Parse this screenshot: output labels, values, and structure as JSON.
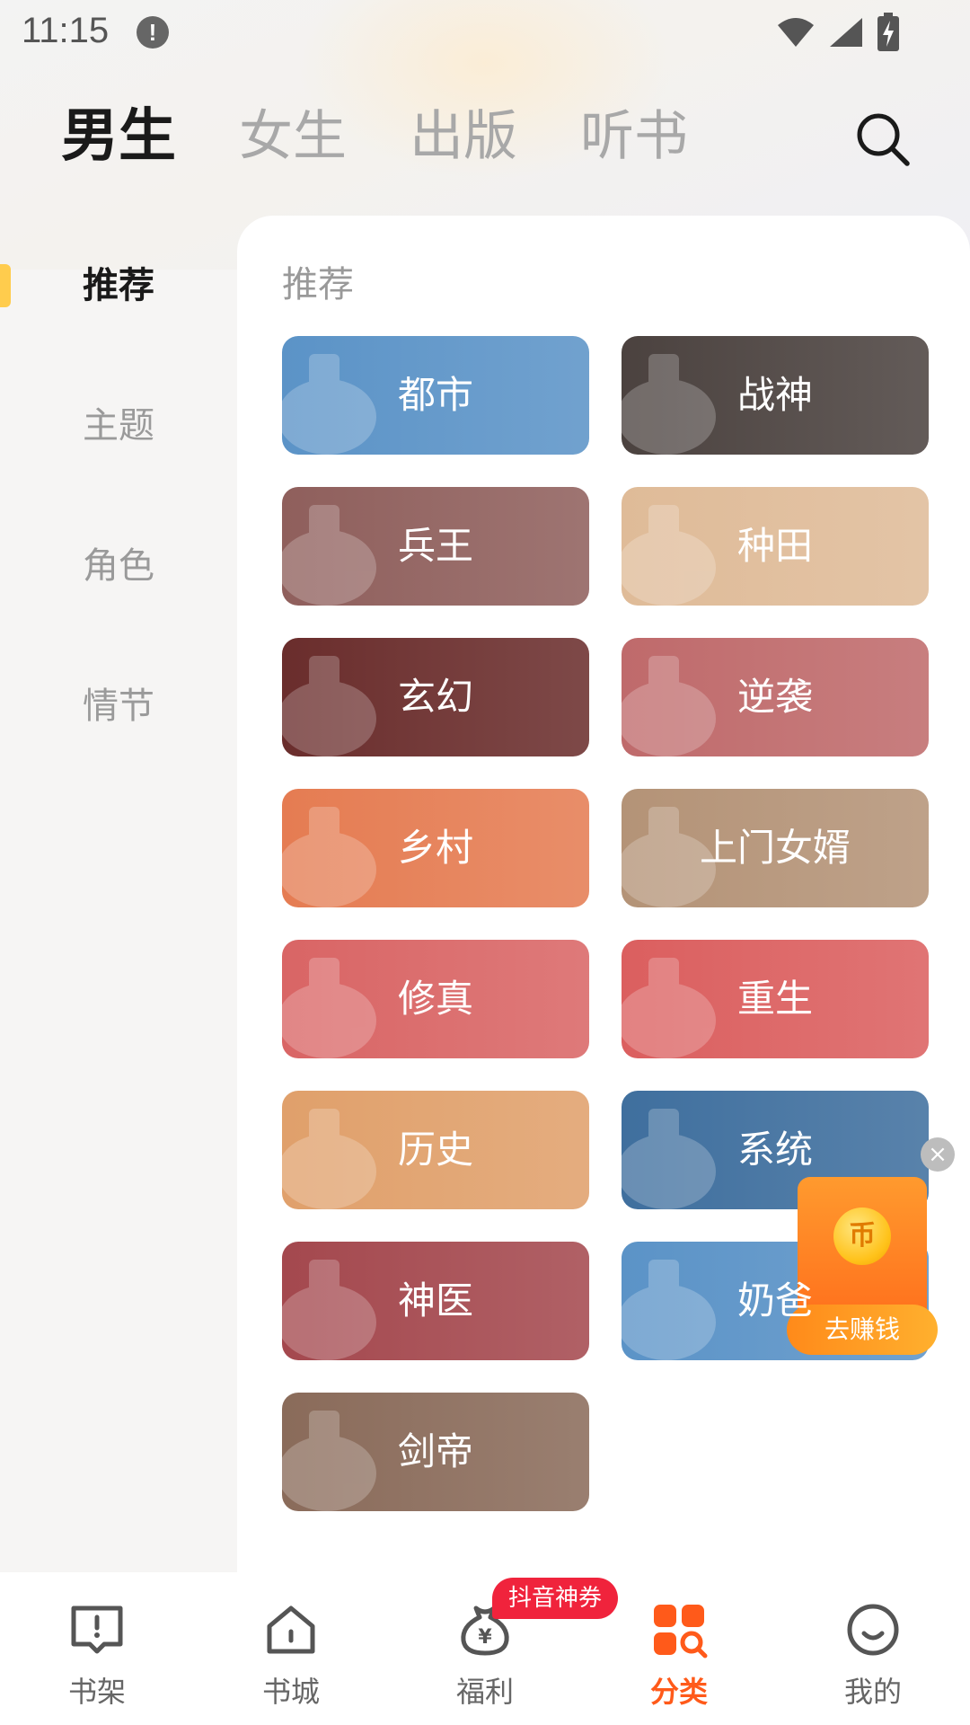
{
  "status_bar": {
    "time": "11:15"
  },
  "top_tabs": [
    {
      "label": "男生",
      "active": true
    },
    {
      "label": "女生",
      "active": false
    },
    {
      "label": "出版",
      "active": false
    },
    {
      "label": "听书",
      "active": false
    }
  ],
  "sidebar": {
    "items": [
      {
        "label": "推荐",
        "active": true
      },
      {
        "label": "主题",
        "active": false
      },
      {
        "label": "角色",
        "active": false
      },
      {
        "label": "情节",
        "active": false
      }
    ]
  },
  "section": {
    "title": "推荐"
  },
  "categories": [
    {
      "label": "都市",
      "color": "#5b93c7"
    },
    {
      "label": "战神",
      "color": "#4b423f"
    },
    {
      "label": "兵王",
      "color": "#8f5f5c"
    },
    {
      "label": "种田",
      "color": "#dfbb98"
    },
    {
      "label": "玄幻",
      "color": "#6a2d2c"
    },
    {
      "label": "逆袭",
      "color": "#bf6a6b"
    },
    {
      "label": "乡村",
      "color": "#e57c52"
    },
    {
      "label": "上门女婿",
      "color": "#b49377"
    },
    {
      "label": "修真",
      "color": "#d96565"
    },
    {
      "label": "重生",
      "color": "#db5f5f"
    },
    {
      "label": "历史",
      "color": "#e0a06b"
    },
    {
      "label": "系统",
      "color": "#3f6f9e"
    },
    {
      "label": "神医",
      "color": "#a4484e"
    },
    {
      "label": "奶爸",
      "color": "#5b93c7"
    },
    {
      "label": "剑帝",
      "color": "#8a6b5a"
    }
  ],
  "floating_reward": {
    "label": "去赚钱",
    "coin_glyph": "币"
  },
  "bottom_nav": {
    "badge": "抖音神券",
    "items": [
      {
        "label": "书架",
        "icon": "bookshelf-icon",
        "active": false
      },
      {
        "label": "书城",
        "icon": "home-icon",
        "active": false
      },
      {
        "label": "福利",
        "icon": "money-bag-icon",
        "active": false
      },
      {
        "label": "分类",
        "icon": "category-icon",
        "active": true
      },
      {
        "label": "我的",
        "icon": "smile-icon",
        "active": false
      }
    ]
  },
  "colors": {
    "accent": "#ff5a1a",
    "indicator": "#ffcc4d",
    "badge": "#f0233c"
  }
}
